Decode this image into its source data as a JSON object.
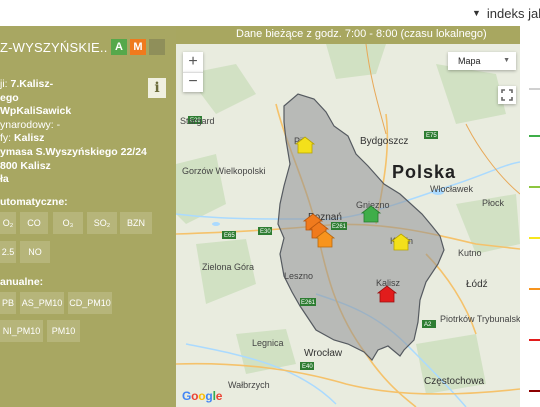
{
  "top_dropdown": {
    "label": "indeks jako"
  },
  "header": {
    "info": "Dane bieżące z godz. 7:00 - 8:00 (czasu lokalnego)"
  },
  "station": {
    "title": "Z-WYSZYŃSKIE..",
    "badges": [
      {
        "label": "A",
        "color": "#55a84b"
      },
      {
        "label": "M",
        "color": "#f07a1d"
      },
      {
        "label": "",
        "color": "#8f8f5a"
      }
    ],
    "info_label": "i",
    "details": [
      {
        "label": "ji: ",
        "value": "7.Kalisz-"
      },
      {
        "label": "",
        "value": "ego"
      },
      {
        "label": "",
        "value": "WpKaliSawick"
      },
      {
        "label": "ynarodowy: -",
        "value": ""
      },
      {
        "label": "fy: ",
        "value": "Kalisz"
      },
      {
        "label": "",
        "value": "ymasa S.Wyszyńskiego 22/24"
      },
      {
        "label": "",
        "value": "800 Kalisz"
      },
      {
        "label": "",
        "value": "ła"
      }
    ]
  },
  "auto_section": {
    "label": "utomatyczne:",
    "chips": [
      "O₂",
      "CO",
      "O₃",
      "SO₂",
      "BZN",
      "2.5",
      "NO"
    ]
  },
  "manual_section": {
    "label": "anualne:",
    "chips": [
      "PB",
      "AS_PM10",
      "CD_PM10",
      "NI_PM10",
      "PM10"
    ]
  },
  "map": {
    "map_type": "Mapa",
    "zoom_in": "+",
    "zoom_out": "−",
    "country_label": "Polska",
    "google": "Google",
    "cities": [
      "Stargard",
      "Bydgoszcz",
      "Gorzów Wielkopolski",
      "Włocławek",
      "Płock",
      "Gniezno",
      "Poznań",
      "Konin",
      "Kutno",
      "Zielona Góra",
      "Leszno",
      "Kalisz",
      "Łódź",
      "Piotrków Trybunalski",
      "Legnica",
      "Wrocław",
      "Wałbrzych",
      "Częstochowa",
      "Piła"
    ],
    "roads": [
      "E28",
      "E75",
      "E261",
      "E30",
      "E65",
      "E40",
      "A2"
    ]
  },
  "legend": {
    "colors": [
      "#d0d0d0",
      "#3fae49",
      "#8dc63f",
      "#f7e61c",
      "#f7941d",
      "#e21c1c",
      "#8b0000"
    ]
  }
}
